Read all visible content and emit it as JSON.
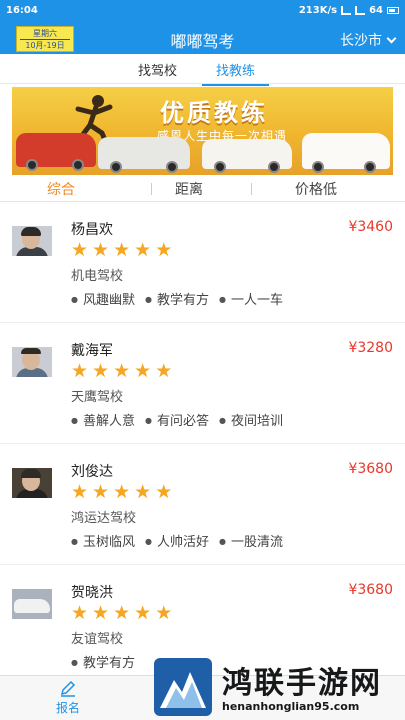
{
  "status_bar": {
    "time": "16:04",
    "speed": "213K/s",
    "battery": "64"
  },
  "header": {
    "title": "嘟嘟驾考",
    "city": "长沙市"
  },
  "date_badge": {
    "weekday": "星期六",
    "date": "10月-19日"
  },
  "top_tabs": [
    "找驾校",
    "找教练"
  ],
  "active_top_tab": "找教练",
  "banner": {
    "headline": "优质教练",
    "subtitle": "感恩人生中每一次相遇"
  },
  "sort_tabs": [
    "综合",
    "距离",
    "价格低"
  ],
  "active_sort_tab": "综合",
  "coaches": [
    {
      "name": "杨昌欢",
      "price": "¥3460",
      "rating": 5,
      "school": "机电驾校",
      "tags": [
        "风趣幽默",
        "教学有方",
        "一人一车"
      ]
    },
    {
      "name": "戴海军",
      "price": "¥3280",
      "rating": 5,
      "school": "天鹰驾校",
      "tags": [
        "善解人意",
        "有问必答",
        "夜间培训"
      ]
    },
    {
      "name": "刘俊达",
      "price": "¥3680",
      "rating": 5,
      "school": "鸿运达驾校",
      "tags": [
        "玉树临风",
        "人帅活好",
        "一股清流"
      ]
    },
    {
      "name": "贺晓洪",
      "price": "¥3680",
      "rating": 5,
      "school": "友谊驾校",
      "tags": [
        "教学有方"
      ]
    }
  ],
  "bottom_nav": {
    "items": [
      {
        "label": "报名",
        "icon": "pen-icon"
      }
    ]
  },
  "watermark": {
    "title": "鸿联手游网",
    "url": "henanhonglian95.com"
  },
  "colors": {
    "primary": "#1e92e6",
    "accent": "#f08a24",
    "price": "#e8382b",
    "star": "#f5a623"
  }
}
